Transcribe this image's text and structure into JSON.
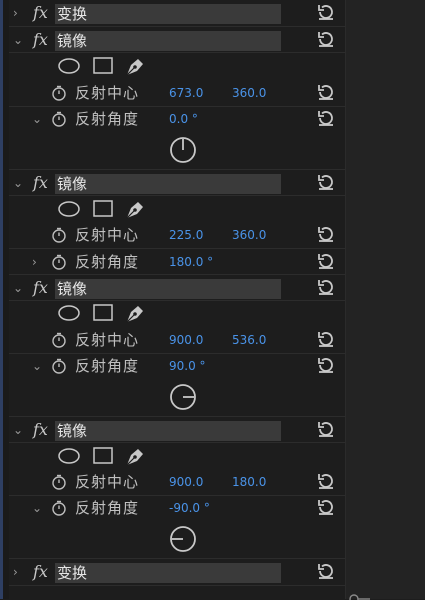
{
  "effects": [
    {
      "fx": "fx",
      "name": "变换"
    },
    {
      "fx": "fx",
      "name": "镜像",
      "center_label": "反射中心",
      "center_x": "673.0",
      "center_y": "360.0",
      "angle_label": "反射角度",
      "angle": "0.0 °"
    },
    {
      "fx": "fx",
      "name": "镜像",
      "center_label": "反射中心",
      "center_x": "225.0",
      "center_y": "360.0",
      "angle_label": "反射角度",
      "angle": "180.0 °"
    },
    {
      "fx": "fx",
      "name": "镜像",
      "center_label": "反射中心",
      "center_x": "900.0",
      "center_y": "536.0",
      "angle_label": "反射角度",
      "angle": "90.0 °"
    },
    {
      "fx": "fx",
      "name": "镜像",
      "center_label": "反射中心",
      "center_x": "900.0",
      "center_y": "180.0",
      "angle_label": "反射角度",
      "angle": "-90.0 °"
    },
    {
      "fx": "fx",
      "name": "变换"
    }
  ],
  "icons": {
    "chevron_collapsed": "›",
    "chevron_expanded": "⌄",
    "reset": "reset-icon",
    "stopwatch": "stopwatch-icon",
    "ellipse": "ellipse-mask-icon",
    "rect": "rectangle-mask-icon",
    "pen": "pen-mask-icon",
    "dial": "angle-dial-icon"
  },
  "colors": {
    "value_blue": "#4a93e8",
    "name_bg": "#3a3a3a",
    "panel_bg": "#1d1d1d"
  }
}
